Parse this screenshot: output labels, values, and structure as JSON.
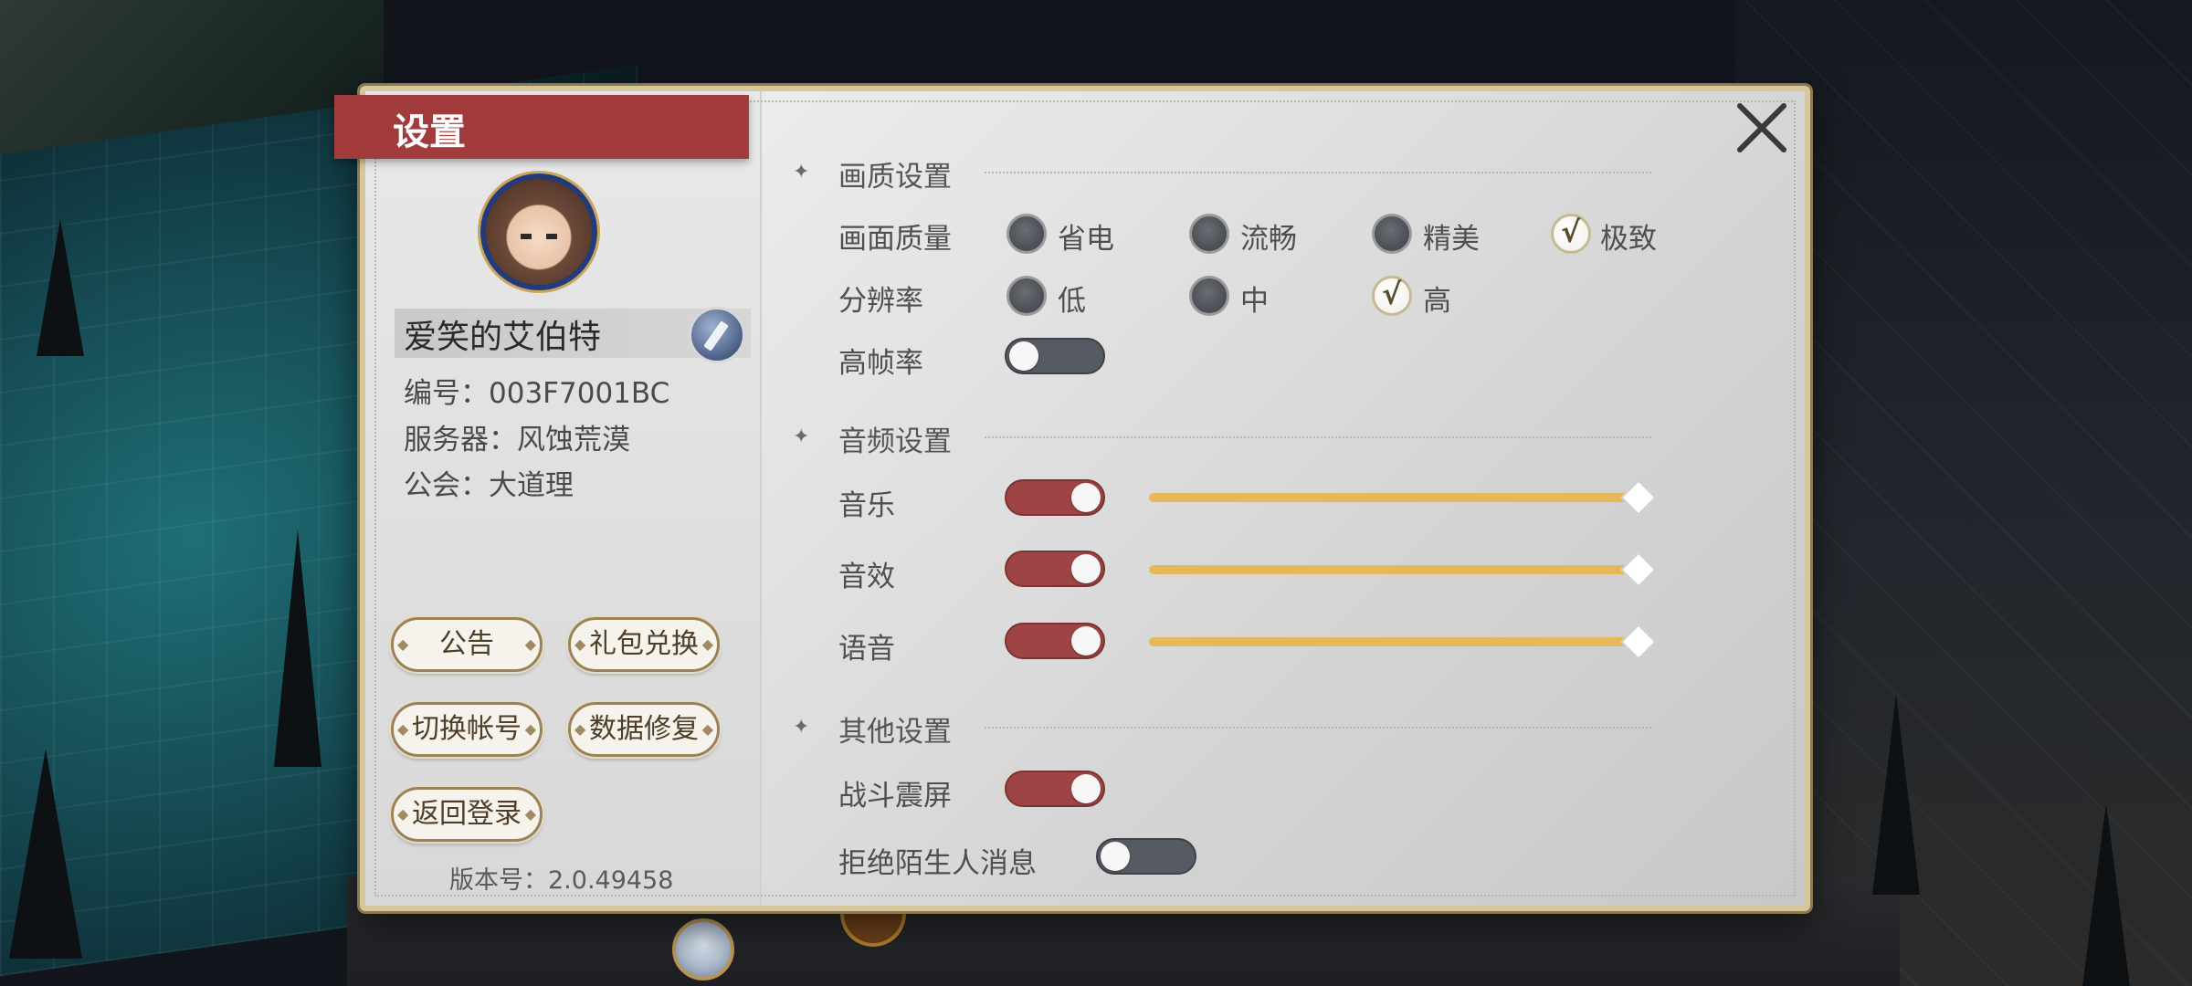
{
  "window": {
    "title": "设置"
  },
  "profile": {
    "name": "爱笑的艾伯特",
    "id_line": "编号：003F7001BC",
    "server_line": "服务器：风蚀荒漠",
    "guild_line": "公会：大道理"
  },
  "buttons": {
    "notice": "公告",
    "gift": "礼包兑换",
    "switch_account": "切换帐号",
    "repair": "数据修复",
    "back_login": "返回登录"
  },
  "version": "版本号：2.0.49458",
  "graphics": {
    "title": "画质设置",
    "quality_label": "画面质量",
    "quality_options": [
      "省电",
      "流畅",
      "精美",
      "极致"
    ],
    "quality_selected": "极致",
    "resolution_label": "分辨率",
    "resolution_options": [
      "低",
      "中",
      "高"
    ],
    "resolution_selected": "高",
    "high_fps_label": "高帧率",
    "high_fps_on": false
  },
  "audio": {
    "title": "音频设置",
    "music_label": "音乐",
    "music_on": true,
    "music_volume": 1.0,
    "sfx_label": "音效",
    "sfx_on": true,
    "sfx_volume": 1.0,
    "voice_label": "语音",
    "voice_on": true,
    "voice_volume": 1.0
  },
  "other": {
    "title": "其他设置",
    "shake_label": "战斗震屏",
    "shake_on": true,
    "reject_label": "拒绝陌生人消息",
    "reject_on": false
  },
  "colors": {
    "accent_red": "#a23c3c",
    "slider_gold": "#e6b85c",
    "toggle_off": "#565a62"
  }
}
